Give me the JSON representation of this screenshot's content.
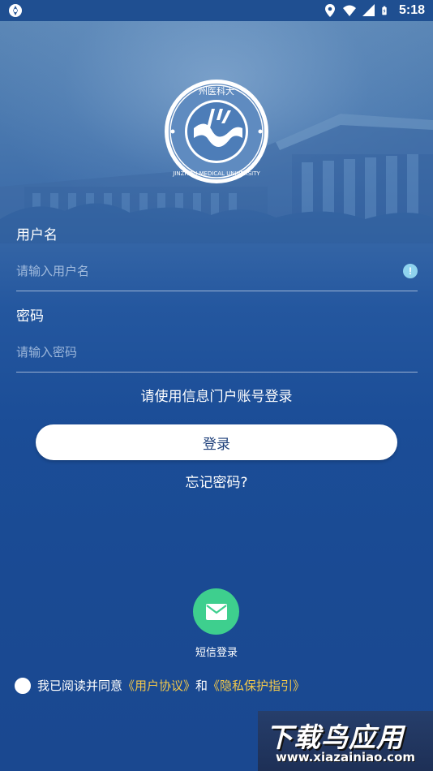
{
  "status_bar": {
    "time": "5:18",
    "icons": [
      "app-notification-icon",
      "location-icon",
      "wifi-icon",
      "signal-icon",
      "battery-icon"
    ]
  },
  "logo": {
    "name": "university-emblem",
    "text": "JINZHOU MEDICAL UNIVERSITY"
  },
  "form": {
    "username_label": "用户名",
    "username_placeholder": "请输入用户名",
    "username_value": "",
    "password_label": "密码",
    "password_placeholder": "请输入密码",
    "password_value": "",
    "hint": "请使用信息门户账号登录",
    "login_button": "登录",
    "forgot_link": "忘记密码?"
  },
  "sms_login": {
    "label": "短信登录",
    "icon": "mail-icon",
    "color": "#3ecf8e"
  },
  "agreement": {
    "prefix": "我已阅读并同意",
    "user_agreement": "《用户协议》",
    "and": "和",
    "privacy": "《隐私保护指引》",
    "checked": false,
    "link_color": "#f2c84b"
  },
  "watermark": {
    "title": "下载鸟应用",
    "url": "www.xiazainiao.com"
  },
  "colors": {
    "background": "#1d4f9a",
    "button_bg": "#ffffff",
    "button_text": "#1d3f7a"
  }
}
